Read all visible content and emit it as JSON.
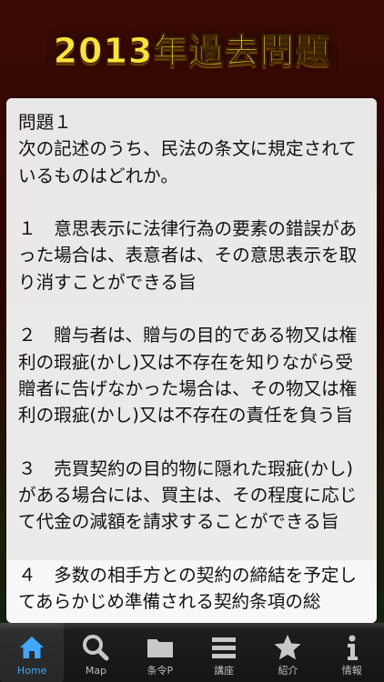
{
  "header": {
    "title": "2013年過去問題"
  },
  "question": {
    "number": "問題１",
    "stem": "次の記述のうち、民法の条文に規定されているものはどれか。",
    "choices": [
      "１　意思表示に法律行為の要素の錯誤があった場合は、表意者は、その意思表示を取り消すことができる旨",
      "２　贈与者は、贈与の目的である物又は権利の瑕疵(かし)又は不存在を知りながら受贈者に告げなかった場合は、その物又は権利の瑕疵(かし)又は不存在の責任を負う旨",
      "３　売買契約の目的物に隠れた瑕疵(かし)がある場合には、買主は、その程度に応じて代金の減額を請求することができる旨",
      "４　多数の相手方との契約の締結を予定してあらかじめ準備される契約条項の総"
    ]
  },
  "tabbar": {
    "active_color": "#3fa8ff",
    "inactive_color": "#bdbdbd",
    "tabs": [
      {
        "label": "Home",
        "icon": "home-icon",
        "active": true
      },
      {
        "label": "Map",
        "icon": "search-icon",
        "active": false
      },
      {
        "label": "条令P",
        "icon": "folder-icon",
        "active": false
      },
      {
        "label": "講座",
        "icon": "list-icon",
        "active": false
      },
      {
        "label": "紹介",
        "icon": "star-icon",
        "active": false
      },
      {
        "label": "情報",
        "icon": "info-icon",
        "active": false
      }
    ]
  }
}
